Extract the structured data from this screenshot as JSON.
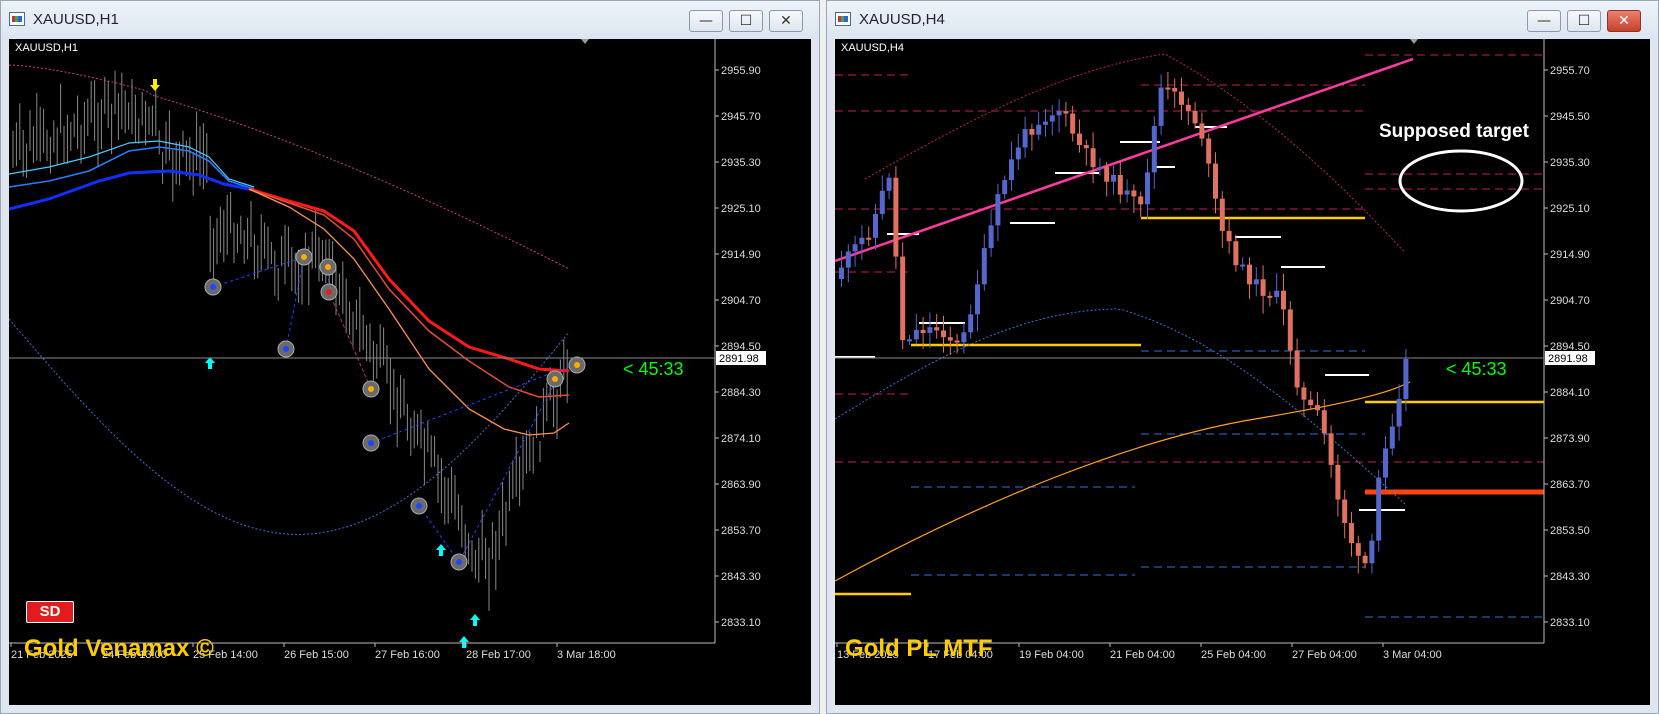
{
  "left_window": {
    "title": "XAUUSD,H1",
    "corner_label": "XAUUSD,H1",
    "sd_badge": "SD",
    "brand": "Gold Venamax ©",
    "countdown": "< 45:33",
    "current_price": "2891.98",
    "price_axis": [
      "2955.90",
      "2945.70",
      "2935.30",
      "2925.10",
      "2914.90",
      "2904.70",
      "2894.50",
      "2884.30",
      "2874.10",
      "2863.90",
      "2853.70",
      "2843.30",
      "2833.10"
    ],
    "time_axis": [
      "21 Feb 2025",
      "24 Feb 13:00",
      "25 Feb 14:00",
      "26 Feb 15:00",
      "27 Feb 16:00",
      "28 Feb 17:00",
      "3 Mar 18:00"
    ]
  },
  "right_window": {
    "title": "XAUUSD,H4",
    "corner_label": "XAUUSD,H4",
    "brand": "Gold PL MTF",
    "annotation": "Supposed target",
    "countdown": "< 45:33",
    "current_price": "2891.98",
    "price_axis": [
      "2955.70",
      "2945.50",
      "2935.30",
      "2925.10",
      "2914.90",
      "2904.70",
      "2894.50",
      "2884.10",
      "2873.90",
      "2863.70",
      "2853.50",
      "2843.30",
      "2833.10"
    ],
    "time_axis": [
      "13 Feb 2025",
      "17 Feb 04:00",
      "19 Feb 04:00",
      "21 Feb 04:00",
      "25 Feb 04:00",
      "27 Feb 04:00",
      "3 Mar 04:00"
    ]
  },
  "window_buttons": {
    "minimize": "—",
    "maximize": "☐",
    "close": "✕"
  },
  "colors": {
    "bull": "#5566cc",
    "bear": "#e07060",
    "accent_yellow": "#ffcc00",
    "countdown_green": "#00ff00",
    "ma_red": "#ff2020"
  }
}
